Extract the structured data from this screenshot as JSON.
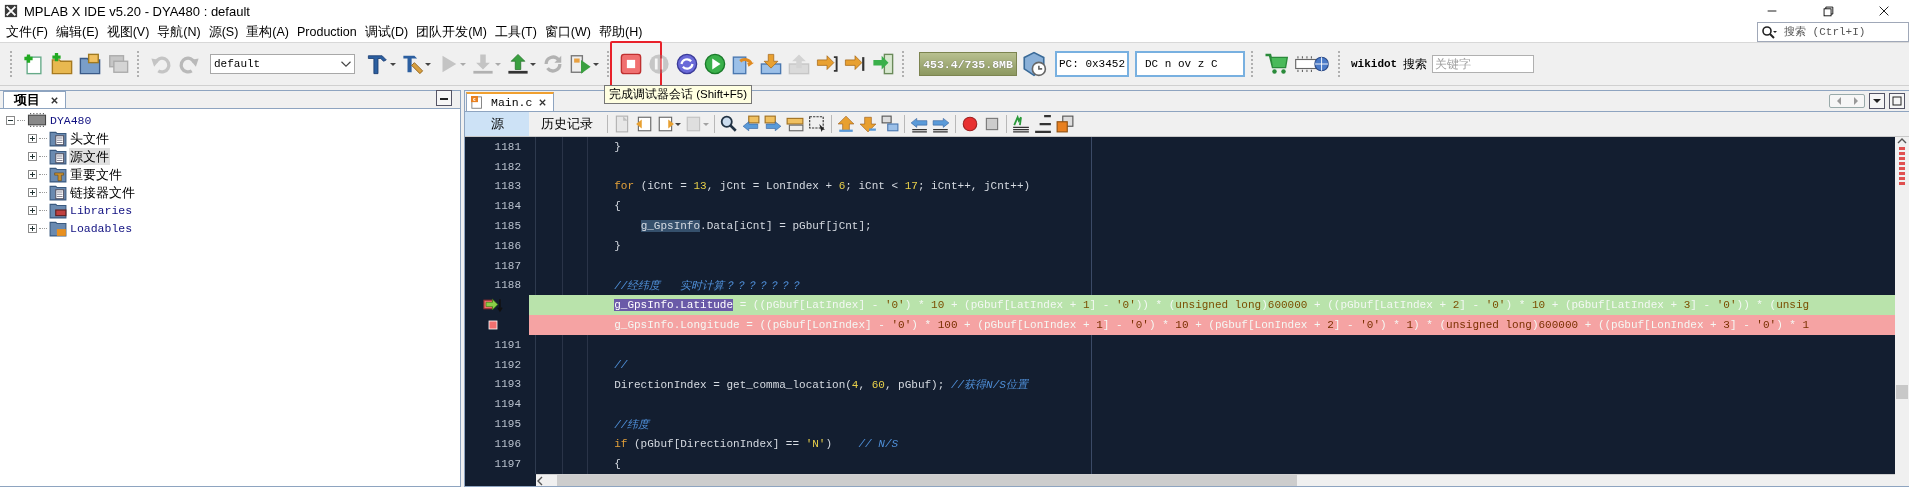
{
  "window": {
    "title": "MPLAB X IDE v5.20 - DYA480 : default"
  },
  "menu": [
    "文件(F)",
    "编辑(E)",
    "视图(V)",
    "导航(N)",
    "源(S)",
    "重构(A)",
    "Production",
    "调试(D)",
    "团队开发(M)",
    "工具(T)",
    "窗口(W)",
    "帮助(H)"
  ],
  "quick_search": {
    "placeholder": "搜索 (Ctrl+I)"
  },
  "toolbar": {
    "buttons": [
      {
        "disabled": false
      },
      {
        "disabled": false
      },
      {
        "disabled": false
      },
      {
        "disabled": true
      },
      {
        "disabled": true
      },
      {
        "disabled": true
      }
    ],
    "configuration": {
      "value": "default"
    },
    "build_buttons": [
      {
        "disabled": false
      },
      {
        "disabled": false
      },
      {
        "disabled": true
      },
      {
        "disabled": true
      },
      {
        "disabled": false
      },
      {
        "disabled": true
      },
      {
        "disabled": false
      }
    ],
    "debug_buttons": [
      {
        "disabled": false
      },
      {
        "disabled": true
      },
      {
        "disabled": false
      },
      {
        "disabled": false
      },
      {
        "disabled": false
      },
      {
        "disabled": false
      },
      {
        "disabled": true
      },
      {
        "disabled": false
      },
      {
        "disabled": false
      },
      {
        "disabled": false
      }
    ],
    "memory": "453.4/735.8MB",
    "pc": "PC: 0x3452",
    "status_flags": "DC n ov z C",
    "wikidot": "wikidot",
    "search_label": "搜索",
    "search": {
      "placeholder": "关键字"
    }
  },
  "tooltip": "完成调试器会话 (Shift+F5)",
  "project_panel": {
    "tab": "项目",
    "tree": [
      {
        "label": "DYA480",
        "expanded": true,
        "selected": false,
        "children": [
          {
            "label": "头文件",
            "expanded": false,
            "selected": false
          },
          {
            "label": "源文件",
            "expanded": false,
            "selected": true
          },
          {
            "label": "重要文件",
            "expanded": false,
            "selected": false
          },
          {
            "label": "链接器文件",
            "expanded": false,
            "selected": false
          },
          {
            "label": "Libraries",
            "expanded": false,
            "selected": false
          },
          {
            "label": "Loadables",
            "expanded": false,
            "selected": false
          }
        ]
      }
    ]
  },
  "editor": {
    "tab": "Main.c",
    "views": [
      {
        "label": "源",
        "selected": true
      },
      {
        "label": "历史记录",
        "selected": false
      }
    ],
    "toolbar": [
      {
        "disabled": true
      },
      {
        "disabled": false
      },
      {
        "disabled": false
      },
      {
        "disabled": true
      },
      {
        "disabled": false
      },
      {
        "disabled": false
      },
      {
        "disabled": false
      },
      {
        "disabled": false
      },
      {
        "disabled": false
      },
      {
        "disabled": false
      },
      {
        "disabled": false
      },
      {
        "disabled": false
      },
      {
        "disabled": false
      },
      {
        "disabled": false
      },
      {
        "disabled": false
      },
      {
        "disabled": false
      },
      {
        "disabled": false
      },
      {
        "disabled": false
      },
      {
        "disabled": false
      }
    ],
    "lines": [
      {
        "number": "1181",
        "segments": [
          {
            "kind": "code",
            "text": "            }"
          }
        ]
      },
      {
        "number": "1182",
        "kind": "code"
      },
      {
        "number": "1183",
        "segments": [
          {
            "kind": "keyword",
            "text": "            for"
          },
          {
            "kind": "code",
            "text": " (iCnt = "
          },
          {
            "kind": "number",
            "text": "13"
          },
          {
            "kind": "code",
            "text": ", jCnt = LonIndex + "
          },
          {
            "kind": "number",
            "text": "6"
          },
          {
            "kind": "code",
            "text": "; iCnt < "
          },
          {
            "kind": "number",
            "text": "17"
          },
          {
            "kind": "code",
            "text": "; iCnt++, jCnt++)"
          }
        ]
      },
      {
        "number": "1184",
        "segments": [
          {
            "kind": "code",
            "text": "            {"
          }
        ]
      },
      {
        "number": "1185",
        "segments": [
          {
            "kind": "mark",
            "text": "                g_GpsInfo"
          },
          {
            "kind": "code",
            "text": ".Data[iCnt] = pGbuf[jCnt];"
          }
        ]
      },
      {
        "number": "1186",
        "segments": [
          {
            "kind": "code",
            "text": "            }"
          }
        ]
      },
      {
        "number": "1187",
        "kind": "code"
      },
      {
        "number": "1188",
        "segments": [
          {
            "kind": "comment",
            "text": "            //经纬度   实时计算？？？？？？？"
          }
        ]
      },
      {
        "kind": "current",
        "segments": [
          {
            "kind": "selection",
            "text": "            g_GpsInfo.Latitude"
          },
          {
            "kind": "code",
            "text": " = ((pGbuf[LatIndex] - "
          },
          {
            "kind": "string",
            "text": "'0'"
          },
          {
            "kind": "code",
            "text": ") * "
          },
          {
            "kind": "number",
            "text": "10"
          },
          {
            "kind": "code",
            "text": " + (pGbuf[LatIndex + "
          },
          {
            "kind": "number",
            "text": "1"
          },
          {
            "kind": "code",
            "text": "] - "
          },
          {
            "kind": "string",
            "text": "'0'"
          },
          {
            "kind": "code",
            "text": ")) * ("
          },
          {
            "kind": "keyword",
            "text": "unsigned long"
          },
          {
            "kind": "code",
            "text": ")"
          },
          {
            "kind": "number",
            "text": "600000"
          },
          {
            "kind": "code",
            "text": " + ((pGbuf[LatIndex + "
          },
          {
            "kind": "number",
            "text": "2"
          },
          {
            "kind": "code",
            "text": "] - "
          },
          {
            "kind": "string",
            "text": "'0'"
          },
          {
            "kind": "code",
            "text": ") * "
          },
          {
            "kind": "number",
            "text": "10"
          },
          {
            "kind": "code",
            "text": " + (pGbuf[LatIndex + "
          },
          {
            "kind": "number",
            "text": "3"
          },
          {
            "kind": "code",
            "text": "] - "
          },
          {
            "kind": "string",
            "text": "'0'"
          },
          {
            "kind": "code",
            "text": ")) * ("
          },
          {
            "kind": "keyword",
            "text": "unsig"
          }
        ]
      },
      {
        "kind": "breakpoint",
        "segments": [
          {
            "kind": "code",
            "text": "            g_GpsInfo.Longitude = ((pGbuf[LonIndex] - "
          },
          {
            "kind": "string",
            "text": "'0'"
          },
          {
            "kind": "code",
            "text": ") * "
          },
          {
            "kind": "number",
            "text": "100"
          },
          {
            "kind": "code",
            "text": " + (pGbuf[LonIndex + "
          },
          {
            "kind": "number",
            "text": "1"
          },
          {
            "kind": "code",
            "text": "] - "
          },
          {
            "kind": "string",
            "text": "'0'"
          },
          {
            "kind": "code",
            "text": ") * "
          },
          {
            "kind": "number",
            "text": "10"
          },
          {
            "kind": "code",
            "text": " + (pGbuf[LonIndex + "
          },
          {
            "kind": "number",
            "text": "2"
          },
          {
            "kind": "code",
            "text": "] - "
          },
          {
            "kind": "string",
            "text": "'0'"
          },
          {
            "kind": "code",
            "text": ") * "
          },
          {
            "kind": "number",
            "text": "1"
          },
          {
            "kind": "code",
            "text": ") * ("
          },
          {
            "kind": "keyword",
            "text": "unsigned long"
          },
          {
            "kind": "code",
            "text": ")"
          },
          {
            "kind": "number",
            "text": "600000"
          },
          {
            "kind": "code",
            "text": " + ((pGbuf[LonIndex + "
          },
          {
            "kind": "number",
            "text": "3"
          },
          {
            "kind": "code",
            "text": "] - "
          },
          {
            "kind": "string",
            "text": "'0'"
          },
          {
            "kind": "code",
            "text": ") * "
          },
          {
            "kind": "number",
            "text": "1"
          }
        ]
      },
      {
        "number": "1191",
        "kind": "code"
      },
      {
        "number": "1192",
        "segments": [
          {
            "kind": "comment",
            "text": "            //"
          }
        ]
      },
      {
        "number": "1193",
        "segments": [
          {
            "kind": "code",
            "text": "            DirectionIndex = get_comma_location("
          },
          {
            "kind": "number",
            "text": "4"
          },
          {
            "kind": "code",
            "text": ", "
          },
          {
            "kind": "number",
            "text": "60"
          },
          {
            "kind": "code",
            "text": ", pGbuf); "
          },
          {
            "kind": "comment",
            "text": "//获得N/S位置"
          }
        ]
      },
      {
        "number": "1194",
        "kind": "code"
      },
      {
        "number": "1195",
        "segments": [
          {
            "kind": "comment",
            "text": "            //纬度"
          }
        ]
      },
      {
        "number": "1196",
        "segments": [
          {
            "kind": "keyword",
            "text": "            if"
          },
          {
            "kind": "code",
            "text": " (pGbuf[DirectionIndex] == "
          },
          {
            "kind": "string",
            "text": "'N'"
          },
          {
            "kind": "code",
            "text": ")    "
          },
          {
            "kind": "comment",
            "text": "// N/S"
          }
        ]
      },
      {
        "number": "1197",
        "segments": [
          {
            "kind": "code",
            "text": "            {"
          }
        ]
      }
    ]
  }
}
